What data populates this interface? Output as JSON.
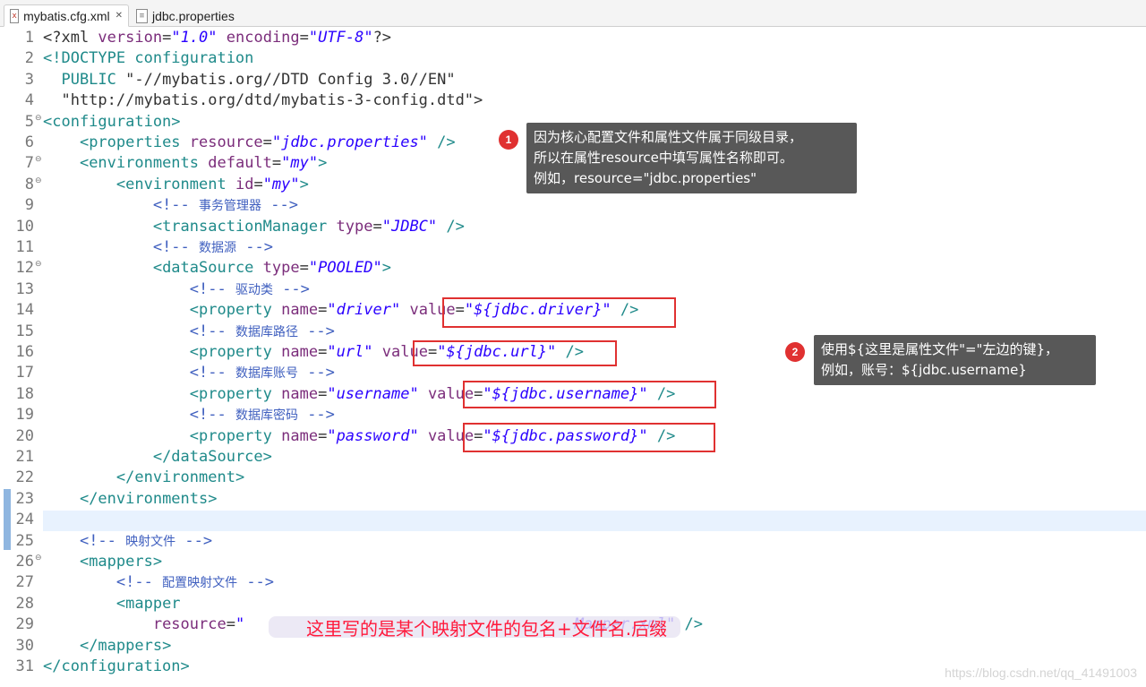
{
  "tabs": [
    {
      "label": "mybatis.cfg.xml",
      "icon": "xml-file-icon",
      "active": true
    },
    {
      "label": "jdbc.properties",
      "icon": "properties-file-icon",
      "active": false
    }
  ],
  "lines": [
    {
      "n": "1",
      "fold": "",
      "segs": [
        [
          "pl",
          "<?xml "
        ],
        [
          "at",
          "version"
        ],
        [
          "pl",
          "="
        ],
        [
          "st",
          "\"1.0\""
        ],
        [
          "pl",
          " "
        ],
        [
          "at",
          "encoding"
        ],
        [
          "pl",
          "="
        ],
        [
          "st",
          "\"UTF-8\""
        ],
        [
          "pl",
          "?>"
        ]
      ]
    },
    {
      "n": "2",
      "fold": "",
      "segs": [
        [
          "tg",
          "<!DOCTYPE configuration"
        ]
      ]
    },
    {
      "n": "3",
      "fold": "",
      "segs": [
        [
          "tg",
          "  PUBLIC "
        ],
        [
          "pl",
          "\"-//mybatis.org//DTD Config 3.0//EN\""
        ]
      ]
    },
    {
      "n": "4",
      "fold": "",
      "segs": [
        [
          "pl",
          "  \"http://mybatis.org/dtd/mybatis-3-config.dtd\">"
        ]
      ]
    },
    {
      "n": "5",
      "fold": "⊖",
      "segs": [
        [
          "tg",
          "<configuration>"
        ]
      ]
    },
    {
      "n": "6",
      "fold": "",
      "segs": [
        [
          "pl",
          "    "
        ],
        [
          "tg",
          "<properties "
        ],
        [
          "at",
          "resource"
        ],
        [
          "pl",
          "="
        ],
        [
          "st",
          "\"jdbc.properties\""
        ],
        [
          "pl",
          " "
        ],
        [
          "tg",
          "/>"
        ]
      ]
    },
    {
      "n": "7",
      "fold": "⊖",
      "segs": [
        [
          "pl",
          "    "
        ],
        [
          "tg",
          "<environments "
        ],
        [
          "at",
          "default"
        ],
        [
          "pl",
          "="
        ],
        [
          "st",
          "\"my\""
        ],
        [
          "tg",
          ">"
        ]
      ]
    },
    {
      "n": "8",
      "fold": "⊖",
      "segs": [
        [
          "pl",
          "        "
        ],
        [
          "tg",
          "<environment "
        ],
        [
          "at",
          "id"
        ],
        [
          "pl",
          "="
        ],
        [
          "st",
          "\"my\""
        ],
        [
          "tg",
          ">"
        ]
      ]
    },
    {
      "n": "9",
      "fold": "",
      "segs": [
        [
          "pl",
          "            "
        ],
        [
          "cm",
          "<!-- "
        ],
        [
          "cn",
          "事务管理器"
        ],
        [
          "cm",
          " -->"
        ]
      ]
    },
    {
      "n": "10",
      "fold": "",
      "segs": [
        [
          "pl",
          "            "
        ],
        [
          "tg",
          "<transactionManager "
        ],
        [
          "at",
          "type"
        ],
        [
          "pl",
          "="
        ],
        [
          "st",
          "\"JDBC\""
        ],
        [
          "pl",
          " "
        ],
        [
          "tg",
          "/>"
        ]
      ]
    },
    {
      "n": "11",
      "fold": "",
      "segs": [
        [
          "pl",
          "            "
        ],
        [
          "cm",
          "<!-- "
        ],
        [
          "cn",
          "数据源"
        ],
        [
          "cm",
          " -->"
        ]
      ]
    },
    {
      "n": "12",
      "fold": "⊖",
      "segs": [
        [
          "pl",
          "            "
        ],
        [
          "tg",
          "<dataSource "
        ],
        [
          "at",
          "type"
        ],
        [
          "pl",
          "="
        ],
        [
          "st",
          "\"POOLED\""
        ],
        [
          "tg",
          ">"
        ]
      ]
    },
    {
      "n": "13",
      "fold": "",
      "segs": [
        [
          "pl",
          "                "
        ],
        [
          "cm",
          "<!-- "
        ],
        [
          "cn",
          "驱动类"
        ],
        [
          "cm",
          " -->"
        ]
      ]
    },
    {
      "n": "14",
      "fold": "",
      "segs": [
        [
          "pl",
          "                "
        ],
        [
          "tg",
          "<property "
        ],
        [
          "at",
          "name"
        ],
        [
          "pl",
          "="
        ],
        [
          "st",
          "\"driver\""
        ],
        [
          "pl",
          " "
        ],
        [
          "at",
          "value"
        ],
        [
          "pl",
          "="
        ],
        [
          "st",
          "\"${jdbc.driver}\""
        ],
        [
          "pl",
          " "
        ],
        [
          "tg",
          "/>"
        ]
      ]
    },
    {
      "n": "15",
      "fold": "",
      "segs": [
        [
          "pl",
          "                "
        ],
        [
          "cm",
          "<!-- "
        ],
        [
          "cn",
          "数据库路径"
        ],
        [
          "cm",
          " -->"
        ]
      ]
    },
    {
      "n": "16",
      "fold": "",
      "segs": [
        [
          "pl",
          "                "
        ],
        [
          "tg",
          "<property "
        ],
        [
          "at",
          "name"
        ],
        [
          "pl",
          "="
        ],
        [
          "st",
          "\"url\""
        ],
        [
          "pl",
          " "
        ],
        [
          "at",
          "value"
        ],
        [
          "pl",
          "="
        ],
        [
          "st",
          "\"${jdbc.url}\""
        ],
        [
          "pl",
          " "
        ],
        [
          "tg",
          "/>"
        ]
      ]
    },
    {
      "n": "17",
      "fold": "",
      "segs": [
        [
          "pl",
          "                "
        ],
        [
          "cm",
          "<!-- "
        ],
        [
          "cn",
          "数据库账号"
        ],
        [
          "cm",
          " -->"
        ]
      ]
    },
    {
      "n": "18",
      "fold": "",
      "segs": [
        [
          "pl",
          "                "
        ],
        [
          "tg",
          "<property "
        ],
        [
          "at",
          "name"
        ],
        [
          "pl",
          "="
        ],
        [
          "st",
          "\"username\""
        ],
        [
          "pl",
          " "
        ],
        [
          "at",
          "value"
        ],
        [
          "pl",
          "="
        ],
        [
          "st",
          "\"${jdbc.username}\""
        ],
        [
          "pl",
          " "
        ],
        [
          "tg",
          "/>"
        ]
      ]
    },
    {
      "n": "19",
      "fold": "",
      "segs": [
        [
          "pl",
          "                "
        ],
        [
          "cm",
          "<!-- "
        ],
        [
          "cn",
          "数据库密码"
        ],
        [
          "cm",
          " -->"
        ]
      ]
    },
    {
      "n": "20",
      "fold": "",
      "segs": [
        [
          "pl",
          "                "
        ],
        [
          "tg",
          "<property "
        ],
        [
          "at",
          "name"
        ],
        [
          "pl",
          "="
        ],
        [
          "st",
          "\"password\""
        ],
        [
          "pl",
          " "
        ],
        [
          "at",
          "value"
        ],
        [
          "pl",
          "="
        ],
        [
          "st",
          "\"${jdbc.password}\""
        ],
        [
          "pl",
          " "
        ],
        [
          "tg",
          "/>"
        ]
      ]
    },
    {
      "n": "21",
      "fold": "",
      "segs": [
        [
          "pl",
          "            "
        ],
        [
          "tg",
          "</dataSource>"
        ]
      ]
    },
    {
      "n": "22",
      "fold": "",
      "segs": [
        [
          "pl",
          "        "
        ],
        [
          "tg",
          "</environment>"
        ]
      ]
    },
    {
      "n": "23",
      "fold": "",
      "segs": [
        [
          "pl",
          "    "
        ],
        [
          "tg",
          "</environments>"
        ]
      ]
    },
    {
      "n": "24",
      "fold": "",
      "segs": []
    },
    {
      "n": "25",
      "fold": "",
      "segs": [
        [
          "pl",
          "    "
        ],
        [
          "cm",
          "<!-- "
        ],
        [
          "cn",
          "映射文件"
        ],
        [
          "cm",
          " -->"
        ]
      ]
    },
    {
      "n": "26",
      "fold": "⊖",
      "segs": [
        [
          "pl",
          "    "
        ],
        [
          "tg",
          "<mappers>"
        ]
      ]
    },
    {
      "n": "27",
      "fold": "",
      "segs": [
        [
          "pl",
          "        "
        ],
        [
          "cm",
          "<!-- "
        ],
        [
          "cn",
          "配置映射文件"
        ],
        [
          "cm",
          " -->"
        ]
      ]
    },
    {
      "n": "28",
      "fold": "",
      "segs": [
        [
          "pl",
          "        "
        ],
        [
          "tg",
          "<mapper"
        ]
      ]
    },
    {
      "n": "29",
      "fold": "",
      "segs": [
        [
          "pl",
          "            "
        ],
        [
          "at",
          "resource"
        ],
        [
          "pl",
          "="
        ],
        [
          "st",
          "\"                                    Mapper.xml\""
        ],
        [
          "pl",
          " "
        ],
        [
          "tg",
          "/>"
        ]
      ]
    },
    {
      "n": "30",
      "fold": "",
      "segs": [
        [
          "pl",
          "    "
        ],
        [
          "tg",
          "</mappers>"
        ]
      ]
    },
    {
      "n": "31",
      "fold": "",
      "segs": [
        [
          "tg",
          "</configuration>"
        ]
      ]
    }
  ],
  "callouts": [
    {
      "badge": "1",
      "lines": [
        "因为核心配置文件和属性文件属于同级目录，",
        "所以在属性resource中填写属性名称即可。",
        "例如，resource=\"jdbc.properties\""
      ]
    },
    {
      "badge": "2",
      "lines": [
        "使用${这里是属性文件\"=\"左边的键}，",
        "例如，账号：${jdbc.username}"
      ]
    }
  ],
  "overlay_note": "这里写的是某个映射文件的包名+文件名.后缀",
  "watermark": "https://blog.csdn.net/qq_41491003",
  "colors": {
    "tag": "#1f8a8a",
    "attr": "#7b2d7b",
    "string": "#2a00ff",
    "comment": "#3f5fbf",
    "highlight_box": "#e03131",
    "callout_bg": "#585858"
  }
}
